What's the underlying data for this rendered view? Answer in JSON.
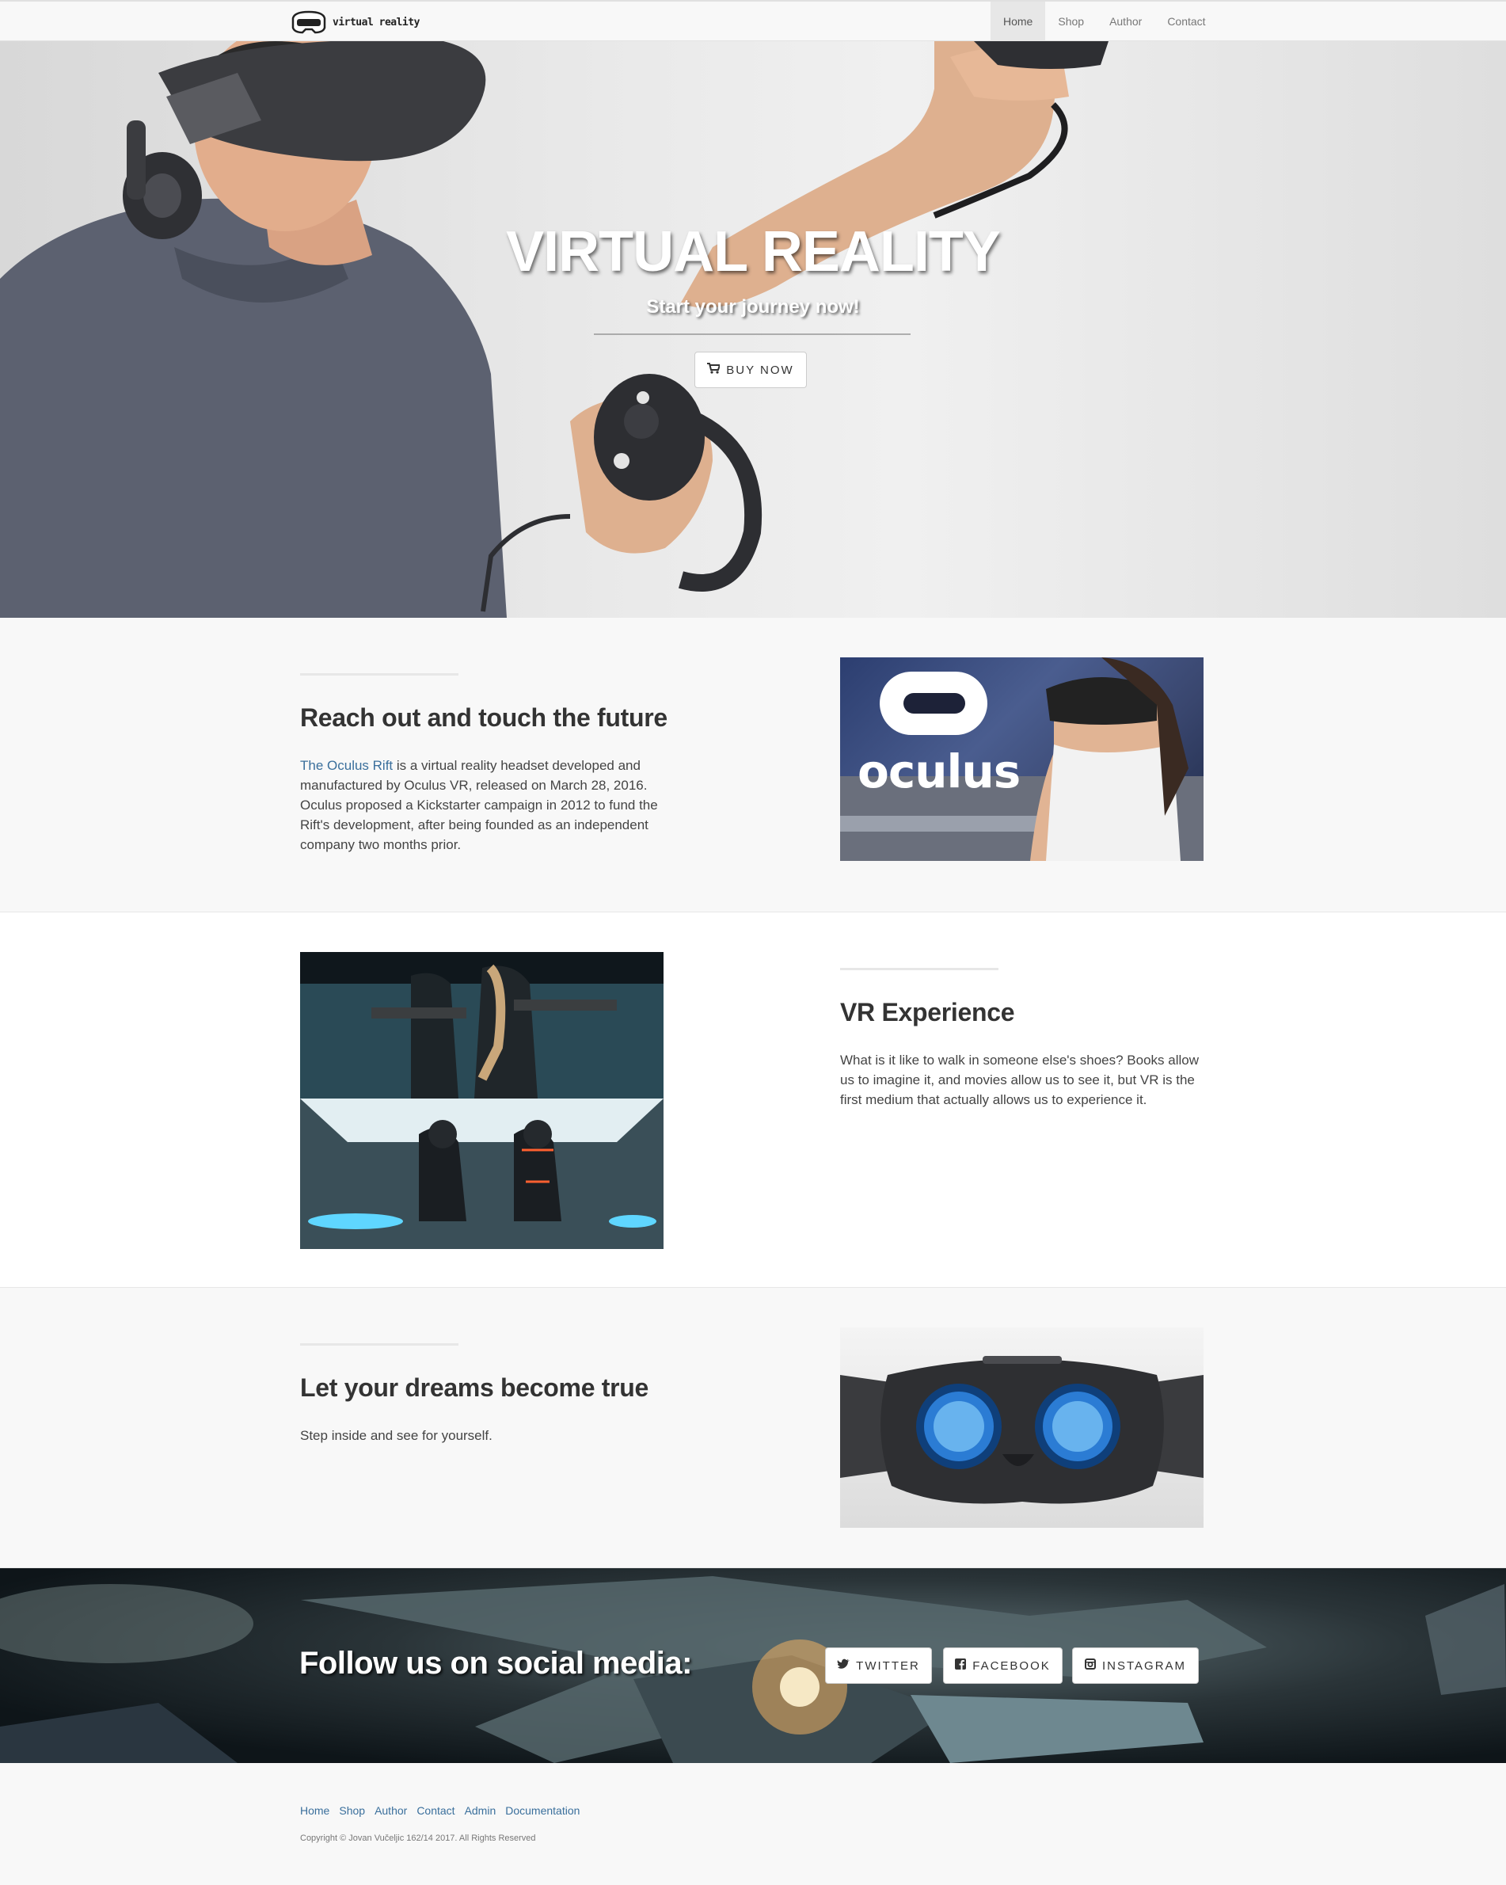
{
  "brand": {
    "logo_icon": "vr-headset-icon",
    "text": "virtual reality"
  },
  "nav": {
    "items": [
      {
        "label": "Home",
        "active": true
      },
      {
        "label": "Shop",
        "active": false
      },
      {
        "label": "Author",
        "active": false
      },
      {
        "label": "Contact",
        "active": false
      }
    ]
  },
  "hero": {
    "title": "VIRTUAL REALITY",
    "subtitle": "Start your journey now!",
    "button_label": "BUY NOW",
    "button_icon": "shopping-cart-icon"
  },
  "sections": [
    {
      "heading": "Reach out and touch the future",
      "link_text": "The Oculus Rift",
      "text": " is a virtual reality headset developed and manufactured by Oculus VR, released on March 28, 2016. Oculus proposed a Kickstarter campaign in 2012 to fund the Rift's development, after being founded as an independent company two months prior.",
      "image_label": "oculus"
    },
    {
      "heading": "VR Experience",
      "text": "What is it like to walk in someone else's shoes? Books allow us to imagine it, and movies allow us to see it, but VR is the first medium that actually allows us to experience it."
    },
    {
      "heading": "Let your dreams become true",
      "text": "Step inside and see for yourself."
    }
  ],
  "social": {
    "title": "Follow us on social media:",
    "buttons": [
      {
        "label": "TWITTER",
        "icon": "twitter-icon"
      },
      {
        "label": "FACEBOOK",
        "icon": "facebook-icon"
      },
      {
        "label": "INSTAGRAM",
        "icon": "instagram-icon"
      }
    ]
  },
  "footer": {
    "links": [
      "Home",
      "Shop",
      "Author",
      "Contact",
      "Admin",
      "Documentation"
    ],
    "copyright": "Copyright © Jovan Vučeljic 162/14 2017. All Rights Reserved"
  },
  "colors": {
    "link": "#3a6f9c",
    "nav_active_bg": "#e7e7e7",
    "page_bg": "#f8f8f8"
  }
}
